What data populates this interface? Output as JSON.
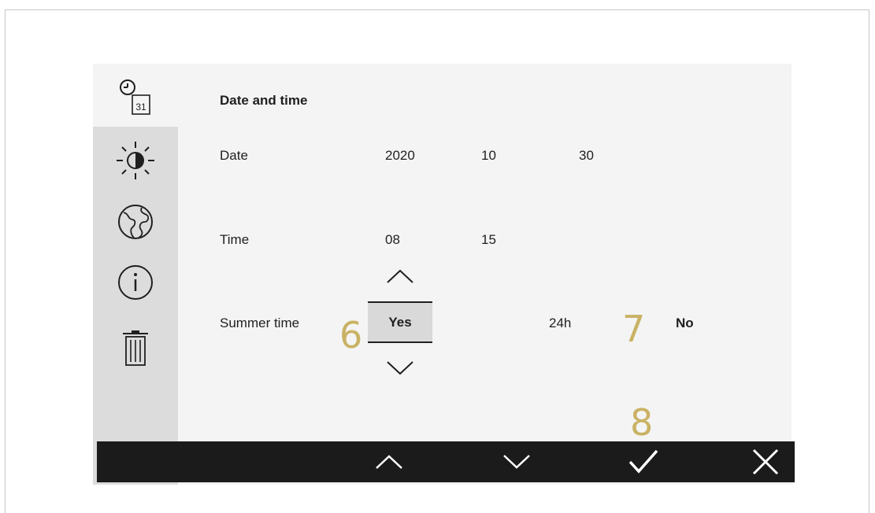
{
  "page": {
    "title": "Date and time"
  },
  "sidebar": {
    "items": [
      {
        "icon": "date-time-icon",
        "label": "31",
        "active": true
      },
      {
        "icon": "brightness-icon",
        "active": false
      },
      {
        "icon": "globe-icon",
        "active": false
      },
      {
        "icon": "info-icon",
        "active": false
      },
      {
        "icon": "trash-icon",
        "active": false
      }
    ]
  },
  "settings": {
    "date": {
      "label": "Date",
      "year": "2020",
      "month": "10",
      "day": "30"
    },
    "time": {
      "label": "Time",
      "hour": "08",
      "minute": "15"
    },
    "summer_time": {
      "label": "Summer time",
      "value": "Yes"
    },
    "format": {
      "value": "24h"
    },
    "extra": {
      "value": "No"
    }
  },
  "callouts": {
    "c6": "6",
    "c7": "7",
    "c8": "8"
  },
  "toolbar": {
    "buttons": [
      "chevron-up-icon",
      "chevron-down-icon",
      "check-icon",
      "close-icon"
    ]
  },
  "colors": {
    "panel": "#f4f4f4",
    "sidebar": "#dcdcdc",
    "toolbar": "#1b1b1b",
    "callout": "#c9b264"
  }
}
